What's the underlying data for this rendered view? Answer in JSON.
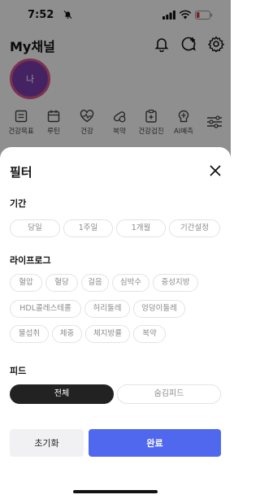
{
  "status_bar": {
    "time": "7:52",
    "icons": [
      "bell-slash-icon",
      "signal-icon",
      "wifi-icon",
      "battery-low-icon"
    ],
    "battery_color": "#e0393e"
  },
  "header": {
    "title": "My채널",
    "icons": [
      "bell-icon",
      "chat-add-icon",
      "gear-icon"
    ]
  },
  "profile": {
    "avatar_initial": "나",
    "avatar_color": "#7b3fb0",
    "avatar_ring_color": "#e0588a"
  },
  "categories": [
    {
      "label": "건강목표",
      "icon": "clipboard-icon"
    },
    {
      "label": "루틴",
      "icon": "calendar-icon"
    },
    {
      "label": "건강",
      "icon": "heart-pulse-icon"
    },
    {
      "label": "복약",
      "icon": "pill-icon"
    },
    {
      "label": "건강검진",
      "icon": "medical-clipboard-icon"
    },
    {
      "label": "AI예측",
      "icon": "ai-brain-icon"
    }
  ],
  "filter_sheet": {
    "title": "필터",
    "period": {
      "label": "기간",
      "options": [
        "당일",
        "1주일",
        "1개월",
        "기간설정"
      ]
    },
    "lifelog": {
      "label": "라이프로그",
      "options": [
        "혈압",
        "혈당",
        "걸음",
        "심박수",
        "중성지방",
        "HDL콜레스테롤",
        "허리둘레",
        "엉덩이둘레",
        "물섭취",
        "체중",
        "체지방률",
        "복약"
      ]
    },
    "feed": {
      "label": "피드",
      "options": [
        "전체",
        "숨김피드"
      ],
      "selected": "전체"
    },
    "reset_label": "초기화",
    "done_label": "완료",
    "accent_color": "#5068ee"
  }
}
